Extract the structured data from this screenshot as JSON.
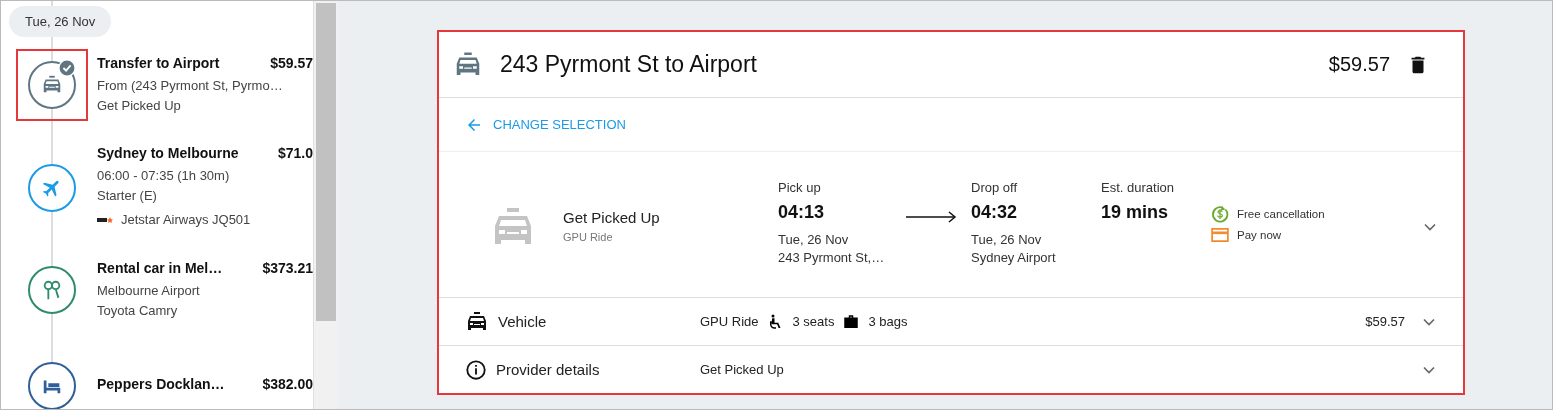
{
  "sidebar": {
    "date": "Tue, 26 Nov",
    "items": [
      {
        "kind": "taxi",
        "title": "Transfer to Airport",
        "price": "$59.57",
        "lines": [
          "From (243 Pyrmont St, Pyrmo…",
          "Get Picked Up"
        ],
        "color": "#5f7682",
        "checked": true,
        "highlighted": true
      },
      {
        "kind": "flight",
        "title": "Sydney to Melbourne",
        "price": "$71.0",
        "lines": [
          "06:00 - 07:35 (1h 30m)",
          "Starter (E)"
        ],
        "airline": "Jetstar Airways JQ501",
        "color": "#1a9be6",
        "checked": false,
        "highlighted": false
      },
      {
        "kind": "car",
        "title": "Rental car in Mel…",
        "price": "$373.21",
        "lines": [
          "Melbourne Airport",
          "Toyota Camry"
        ],
        "color": "#2e8b6e",
        "checked": false,
        "highlighted": false
      },
      {
        "kind": "hotel",
        "title": "Peppers Docklan…",
        "price": "$382.00",
        "color": "#2f5f9a",
        "checked": false,
        "highlighted": false
      }
    ]
  },
  "card": {
    "highlighted": true,
    "title": "243 Pyrmont St to Airport",
    "price": "$59.57",
    "back_link": "CHANGE SELECTION",
    "option": {
      "name": "Get Picked Up",
      "subtitle": "GPU Ride",
      "pickup": {
        "label": "Pick up",
        "time": "04:13",
        "date": "Tue, 26 Nov",
        "place": "243 Pyrmont St,…"
      },
      "dropoff": {
        "label": "Drop off",
        "time": "04:32",
        "date": "Tue, 26 Nov",
        "place": "Sydney Airport"
      },
      "duration": {
        "label": "Est. duration",
        "value": "19 mins"
      },
      "badges": [
        {
          "kind": "refund",
          "text": "Free cancellation",
          "color": "#6aaa2c"
        },
        {
          "kind": "card",
          "text": "Pay now",
          "color": "#f28b30"
        }
      ]
    },
    "sections": [
      {
        "kind": "vehicle",
        "title": "Vehicle",
        "summary": "GPU Ride",
        "seats": "3 seats",
        "bags": "3 bags",
        "price": "$59.57"
      },
      {
        "kind": "info",
        "title": "Provider details",
        "summary": "Get Picked Up"
      }
    ]
  }
}
